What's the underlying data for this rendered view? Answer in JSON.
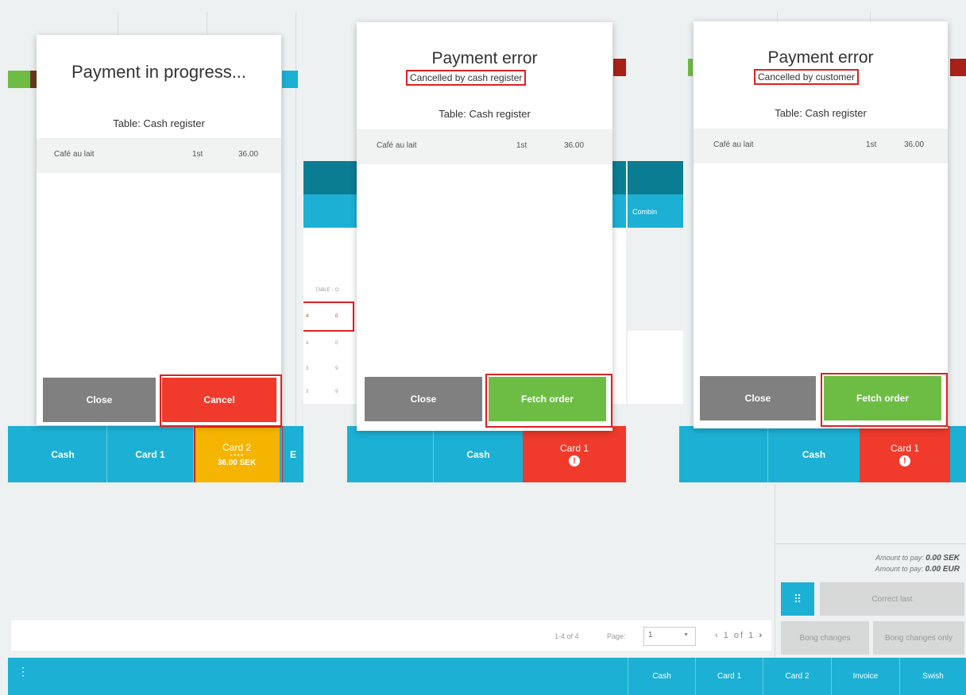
{
  "panel1": {
    "title": "Payment in progress...",
    "table": "Table: Cash register",
    "item": {
      "name": "Café au lait",
      "course": "1st",
      "price": "36.00"
    },
    "close": "Close",
    "cancel": "Cancel",
    "pay": {
      "cash": "Cash",
      "card1": "Card 1",
      "card2": "Card 2",
      "card2_dots": "• • • •",
      "card2_amount": "36.00 SEK",
      "cut": "E"
    }
  },
  "panel2": {
    "title": "Payment error",
    "subtitle": "Cancelled by cash register",
    "table": "Table: Cash register",
    "item": {
      "name": "Café au lait",
      "course": "1st",
      "price": "36.00"
    },
    "close": "Close",
    "fetch": "Fetch order",
    "pay": {
      "cash": "Cash",
      "card1": "Card 1"
    },
    "bg_table": {
      "header": "TABLE ↓ O",
      "rows": [
        [
          "4",
          "0"
        ],
        [
          "4",
          "0"
        ],
        [
          "3",
          "9"
        ],
        [
          "3",
          "9"
        ]
      ]
    }
  },
  "panel3": {
    "title": "Payment error",
    "subtitle": "Cancelled by customer",
    "table": "Table: Cash register",
    "item": {
      "name": "Café au lait",
      "course": "1st",
      "price": "36.00"
    },
    "close": "Close",
    "fetch": "Fetch order",
    "pay": {
      "cash": "Cash",
      "card1": "Card 1"
    },
    "combine": "Combin"
  },
  "right": {
    "amount_sek_label": "Amount to pay:",
    "amount_sek": "0.00 SEK",
    "amount_eur_label": "Amount to pay:",
    "amount_eur": "0.00 EUR",
    "correct_last": "Correct last",
    "bong_changes": "Bong changes",
    "bong_changes_only": "Bong changes only"
  },
  "pager": {
    "range": "1-4 of 4",
    "page_label": "Page:",
    "page_value": "1",
    "prev": "‹",
    "page_of": "1 of 1",
    "next": "›"
  },
  "bottom": {
    "cash": "Cash",
    "card1": "Card 1",
    "card2": "Card 2",
    "invoice": "Invoice",
    "swish": "Swish"
  },
  "colors": {
    "accent": "#1cb0d4",
    "danger": "#f03a2b",
    "success": "#6dbd45",
    "warning": "#f5b400",
    "neutral": "#808080"
  }
}
